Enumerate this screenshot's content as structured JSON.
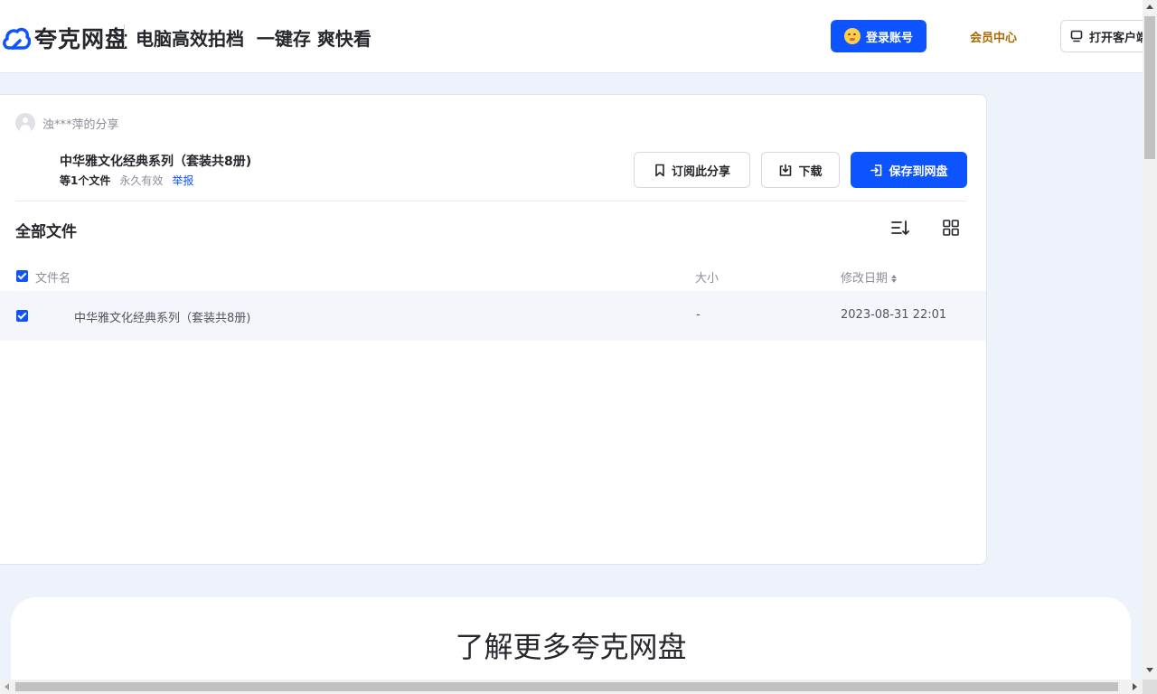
{
  "header": {
    "logo_text": "夸克网盘",
    "slogan": "电脑高效拍档  一键存 爽快看",
    "login_label": "登录账号",
    "member_label": "会员中心",
    "client_label": "打开客户端"
  },
  "share": {
    "sharer": "浊***萍的分享",
    "title": "中华雅文化经典系列（套装共8册)",
    "file_count": "等1个文件",
    "validity": "永久有效",
    "report": "举报",
    "subscribe_label": "订阅此分享",
    "download_label": "下载",
    "save_label": "保存到网盘"
  },
  "files": {
    "section_title": "全部文件",
    "columns": {
      "name": "文件名",
      "size": "大小",
      "modified": "修改日期"
    },
    "rows": [
      {
        "name": "中华雅文化经典系列（套装共8册)",
        "size": "-",
        "modified": "2023-08-31 22:01",
        "checked": true
      }
    ]
  },
  "promo": {
    "title": "了解更多夸克网盘"
  },
  "colors": {
    "accent": "#0d53ff",
    "member": "#a86a00",
    "page_bg": "#eef2fb"
  }
}
